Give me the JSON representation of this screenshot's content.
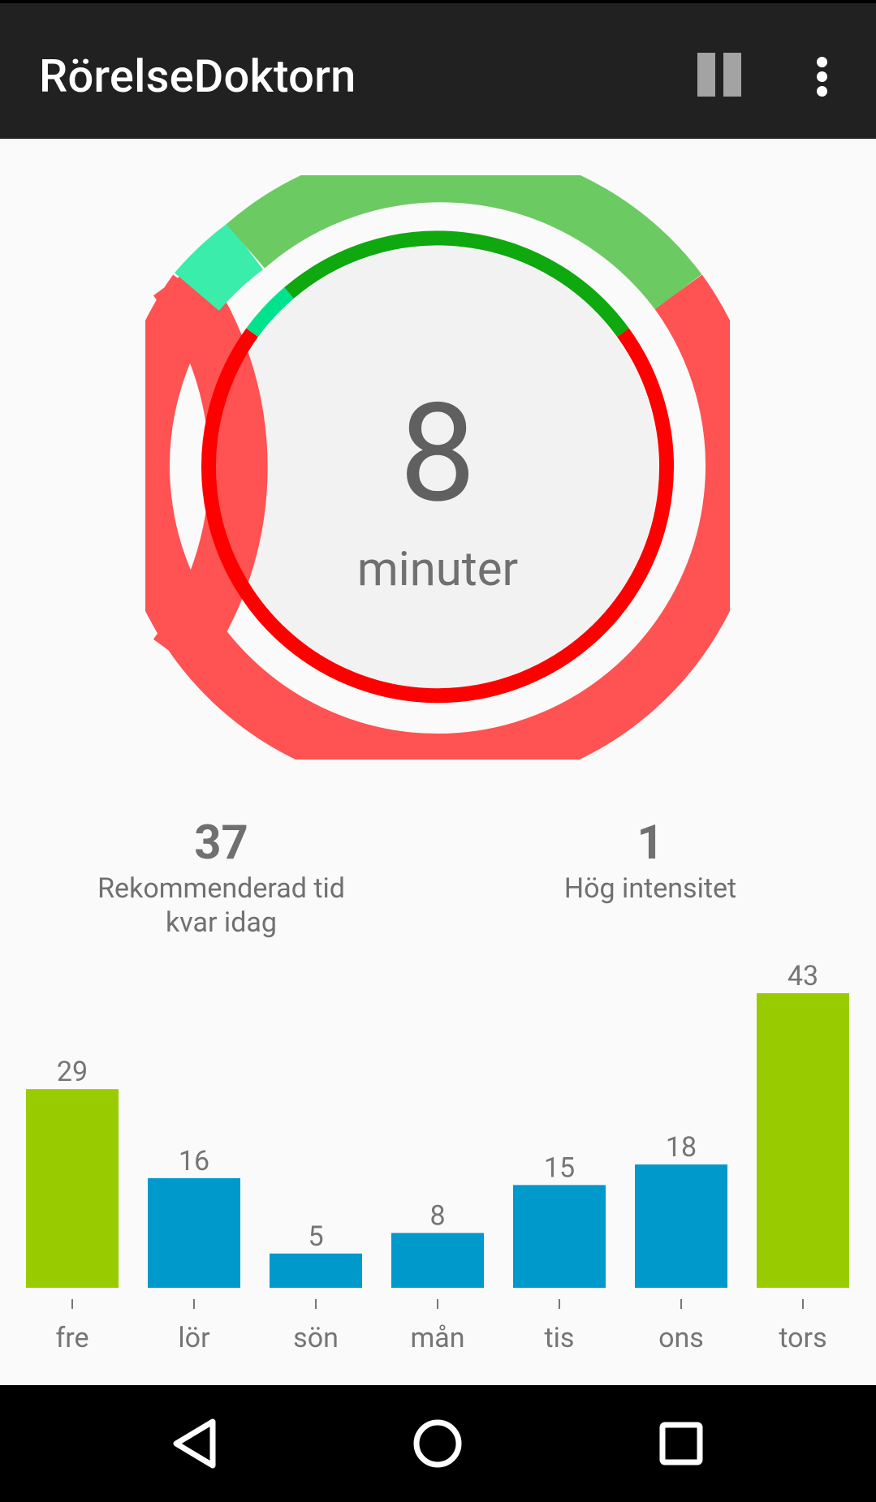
{
  "app": {
    "title": "RörelseDoktorn",
    "pause_icon": "pause-icon",
    "menu_icon": "more-vert-icon"
  },
  "today": {
    "minutes": "8",
    "unit": "minuter"
  },
  "stats": {
    "remaining_value": "37",
    "remaining_label_line1": "Rekommenderad tid",
    "remaining_label_line2": "kvar idag",
    "high_value": "1",
    "high_label": "Hög intensitet"
  },
  "colors": {
    "ring_light": "#6cca62",
    "ring_dark": "#0fa80f",
    "high_light": "#3aedaa",
    "high_dark": "#00e28c",
    "remaining_light": "#ff5252",
    "remaining_dark": "#ff0000",
    "inner_circle": "#f2f2f2",
    "bar_goal_met": "#99cc00",
    "bar_normal": "#0099cc",
    "text_gray": "#757575"
  },
  "chart_data": {
    "type": "bar",
    "categories": [
      "fre",
      "lör",
      "sön",
      "mån",
      "tis",
      "ons",
      "tors"
    ],
    "values": [
      29,
      16,
      5,
      8,
      15,
      18,
      43
    ],
    "goal_met": [
      true,
      false,
      false,
      false,
      false,
      false,
      true
    ],
    "title": "",
    "xlabel": "",
    "ylabel": "",
    "ylim": [
      0,
      43
    ],
    "grid": false
  },
  "nav": {
    "back_icon": "back-triangle-icon",
    "home_icon": "home-circle-icon",
    "recents_icon": "recents-square-icon"
  }
}
